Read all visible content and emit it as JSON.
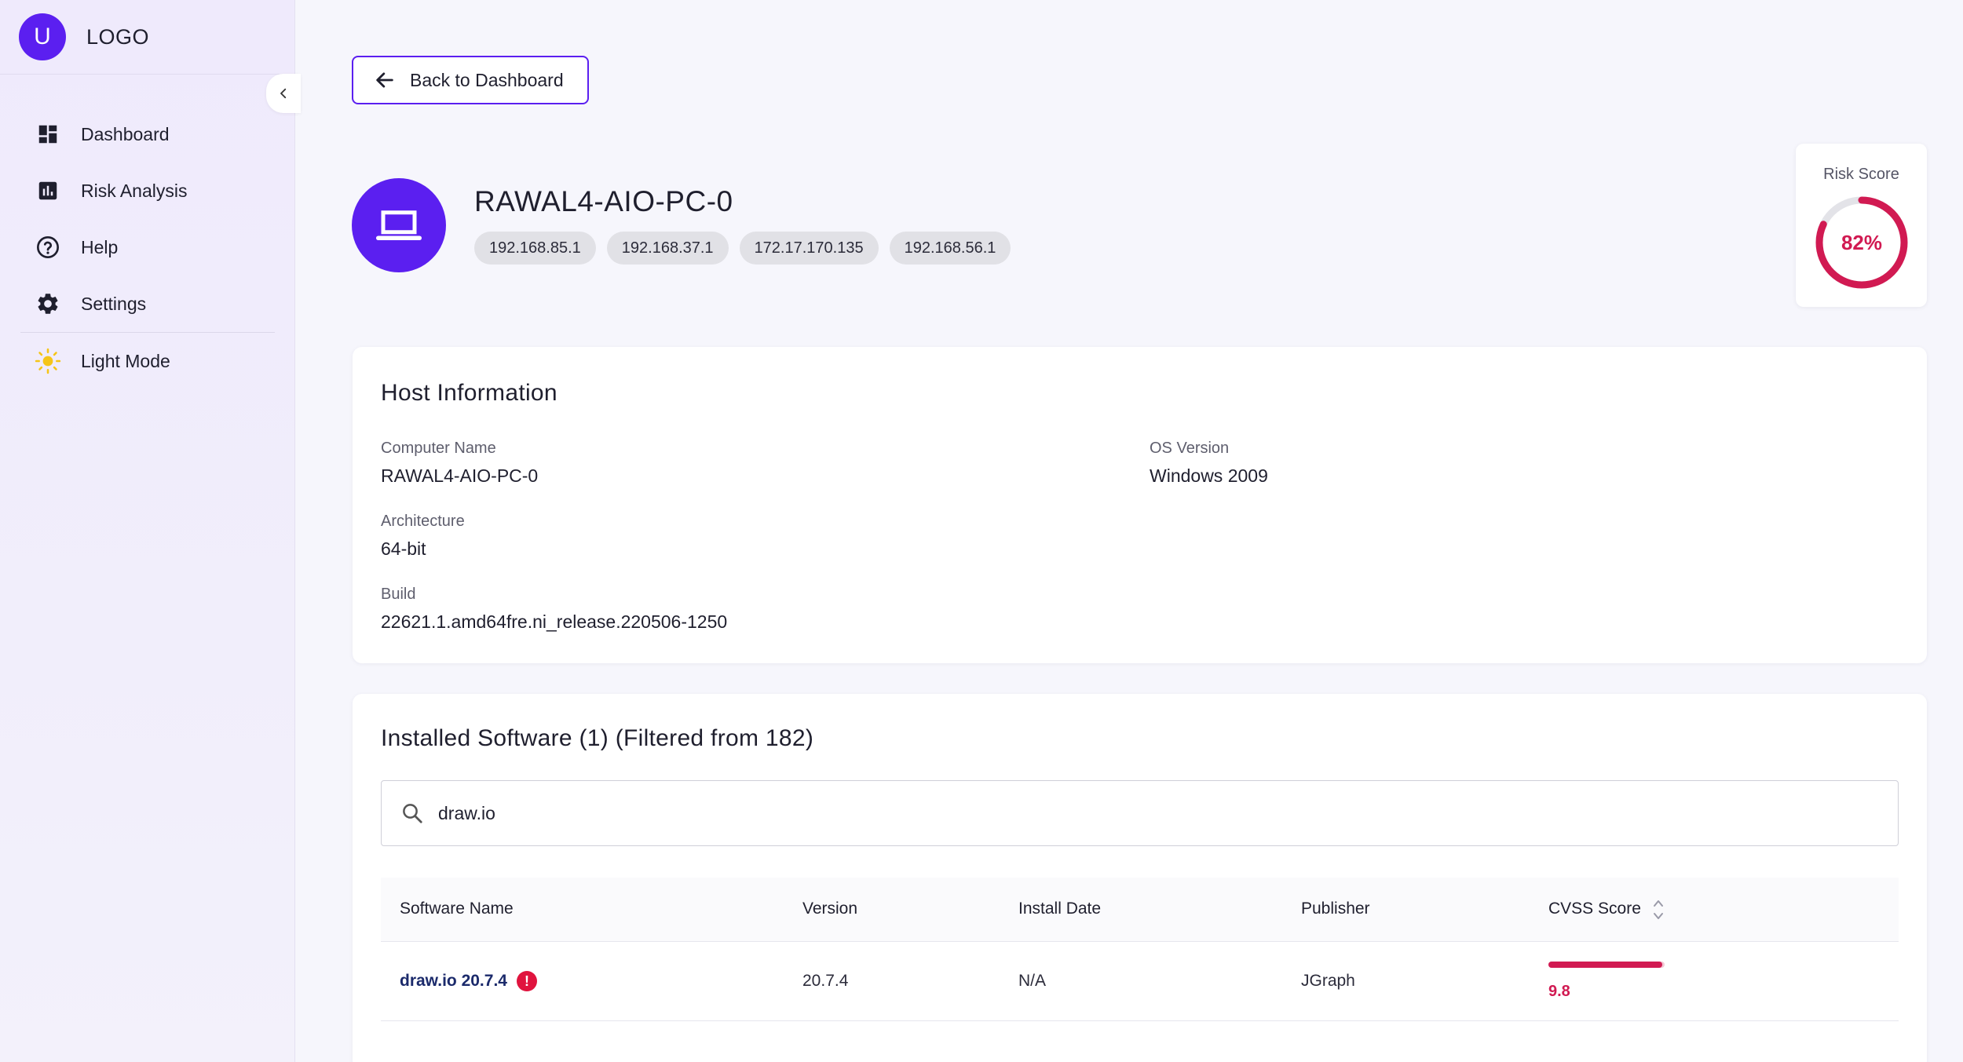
{
  "sidebar": {
    "avatar_letter": "U",
    "logo_text": "LOGO",
    "items": [
      {
        "label": "Dashboard",
        "icon": "dashboard-icon"
      },
      {
        "label": "Risk Analysis",
        "icon": "bar-chart-icon"
      },
      {
        "label": "Help",
        "icon": "help-circle-icon"
      },
      {
        "label": "Settings",
        "icon": "gear-icon"
      }
    ],
    "theme_toggle": {
      "label": "Light Mode",
      "icon": "sun-icon"
    }
  },
  "back_button": {
    "label": "Back to Dashboard",
    "icon": "arrow-left-icon"
  },
  "host": {
    "name": "RAWAL4-AIO-PC-0",
    "icon": "laptop-icon",
    "ips": [
      "192.168.85.1",
      "192.168.37.1",
      "172.17.170.135",
      "192.168.56.1"
    ]
  },
  "risk": {
    "label": "Risk Score",
    "value_text": "82%",
    "value": 0.82,
    "color": "#d11a52"
  },
  "host_info": {
    "title": "Host Information",
    "computer_name_label": "Computer Name",
    "computer_name": "RAWAL4-AIO-PC-0",
    "os_version_label": "OS Version",
    "os_version": "Windows 2009",
    "architecture_label": "Architecture",
    "architecture": "64-bit",
    "build_label": "Build",
    "build": "22621.1.amd64fre.ni_release.220506-1250"
  },
  "software": {
    "title": "Installed Software (1) (Filtered from 182)",
    "search_value": "draw.io",
    "columns": [
      "Software Name",
      "Version",
      "Install Date",
      "Publisher",
      "CVSS Score"
    ],
    "rows": [
      {
        "name": "draw.io 20.7.4",
        "version": "20.7.4",
        "install_date": "N/A",
        "publisher": "JGraph",
        "cvss": "9.8",
        "cvss_value": 9.8
      }
    ]
  },
  "colors": {
    "accent": "#5b1ff0",
    "danger": "#d11a52"
  }
}
